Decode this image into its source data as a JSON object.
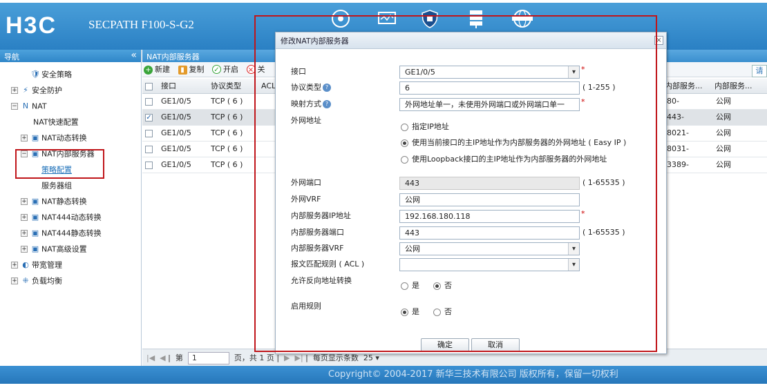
{
  "header": {
    "logo": "H3C",
    "product": "SECPATH F100-S-G2",
    "icons": [
      "dashboard-icon",
      "monitor-icon",
      "shield-icon",
      "server-icon",
      "internet-icon"
    ]
  },
  "sidebar": {
    "title": "导航",
    "collapse": "«",
    "items": [
      {
        "label": "安全策略",
        "icon": "🛡",
        "level": 1,
        "toggle": ""
      },
      {
        "label": "安全防护",
        "icon": "⚡",
        "level": 0,
        "toggle": "+"
      },
      {
        "label": "NAT",
        "icon": "N",
        "level": 0,
        "toggle": "−"
      },
      {
        "label": "NAT快速配置",
        "icon": "",
        "level": 2,
        "toggle": ""
      },
      {
        "label": "NAT动态转换",
        "icon": "▣",
        "level": 1,
        "toggle": "+"
      },
      {
        "label": "NAT内部服务器",
        "icon": "▣",
        "level": 1,
        "toggle": "−"
      },
      {
        "label": "策略配置",
        "icon": "",
        "level": 3,
        "toggle": ""
      },
      {
        "label": "服务器组",
        "icon": "",
        "level": 3,
        "toggle": ""
      },
      {
        "label": "NAT静态转换",
        "icon": "▣",
        "level": 1,
        "toggle": "+"
      },
      {
        "label": "NAT444动态转换",
        "icon": "▣",
        "level": 1,
        "toggle": "+"
      },
      {
        "label": "NAT444静态转换",
        "icon": "▣",
        "level": 1,
        "toggle": "+"
      },
      {
        "label": "NAT高级设置",
        "icon": "▣",
        "level": 1,
        "toggle": "+"
      },
      {
        "label": "带宽管理",
        "icon": "◐",
        "level": 0,
        "toggle": "+"
      },
      {
        "label": "负载均衡",
        "icon": "⁜",
        "level": 0,
        "toggle": "+"
      }
    ]
  },
  "main": {
    "title": "NAT内部服务器",
    "toolbar": {
      "new": "新建",
      "copy": "复制",
      "enable": "开启",
      "delete": "关",
      "search": "请"
    },
    "columns": [
      "接口",
      "协议类型",
      "ACL",
      "内部服务...",
      "内部服务..."
    ],
    "rows": [
      {
        "iface": "GE1/0/5",
        "proto": "TCP ( 6 )",
        "acl": "",
        "port": "80-",
        "vrf": "公网",
        "checked": ""
      },
      {
        "iface": "GE1/0/5",
        "proto": "TCP ( 6 )",
        "acl": "",
        "port": "443-",
        "vrf": "公网",
        "checked": "✓"
      },
      {
        "iface": "GE1/0/5",
        "proto": "TCP ( 6 )",
        "acl": "",
        "port": "8021-",
        "vrf": "公网",
        "checked": ""
      },
      {
        "iface": "GE1/0/5",
        "proto": "TCP ( 6 )",
        "acl": "",
        "port": "8031-",
        "vrf": "公网",
        "checked": ""
      },
      {
        "iface": "GE1/0/5",
        "proto": "TCP ( 6 )",
        "acl": "",
        "port": "3389-",
        "vrf": "公网",
        "checked": ""
      }
    ],
    "pager": {
      "page_label": "第",
      "page": "1",
      "of": "页，共 1 页",
      "per_page_label": "每页显示条数",
      "per_page": "25"
    }
  },
  "dialog": {
    "title": "修改NAT内部服务器",
    "close": "×",
    "fields": {
      "iface_label": "接口",
      "iface_value": "GE1/0/5",
      "proto_label": "协议类型",
      "proto_value": "6",
      "proto_range": "( 1-255 )",
      "map_label": "映射方式",
      "map_value": "外网地址单一，未使用外网端口或外网端口单一",
      "ext_addr_label": "外网地址",
      "opt1": "指定IP地址",
      "opt2": "使用当前接口的主IP地址作为内部服务器的外网地址 ( Easy IP )",
      "opt3": "使用Loopback接口的主IP地址作为内部服务器的外网地址",
      "ext_port_label": "外网端口",
      "ext_port_value": "443",
      "ext_port_range": "( 1-65535 )",
      "ext_vrf_label": "外网VRF",
      "ext_vrf_value": "公网",
      "int_ip_label": "内部服务器IP地址",
      "int_ip_value": "192.168.180.118",
      "int_port_label": "内部服务器端口",
      "int_port_value": "443",
      "int_port_range": "( 1-65535 )",
      "int_vrf_label": "内部服务器VRF",
      "int_vrf_value": "公网",
      "acl_label": "报文匹配规则 ( ACL )",
      "acl_value": "",
      "reverse_label": "允许反向地址转换",
      "yes": "是",
      "no": "否",
      "enable_label": "启用规则"
    },
    "required_mark": "*",
    "ok": "确定",
    "cancel": "取消"
  },
  "footer": {
    "copyright": "Copyright© 2004-2017 新华三技术有限公司 版权所有，保留一切权利"
  }
}
